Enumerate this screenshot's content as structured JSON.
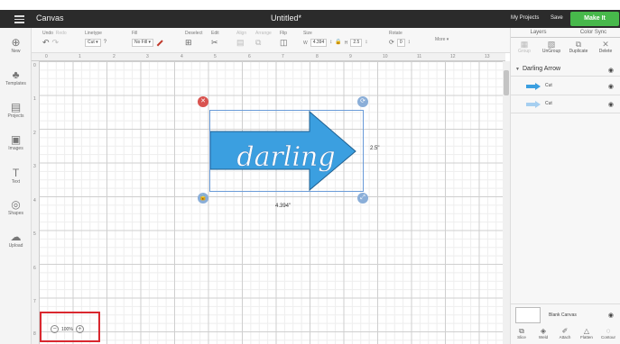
{
  "header": {
    "app_title": "Canvas",
    "doc_title": "Untitled*",
    "my_projects": "My Projects",
    "save": "Save",
    "make_it": "Make It"
  },
  "toolbar": {
    "undo": "Undo",
    "redo": "Redo",
    "linetype_label": "Linetype",
    "linetype_value": "Cut",
    "fill_label": "Fill",
    "fill_value": "No Fill",
    "deselect": "Deselect",
    "edit": "Edit",
    "align": "Align",
    "arrange": "Arrange",
    "flip": "Flip",
    "size_label": "Size",
    "w_label": "W",
    "w_value": "4.394",
    "h_label": "H",
    "h_value": "2.5",
    "rotate_label": "Rotate",
    "rotate_value": "0",
    "more": "More ▾",
    "question": "?"
  },
  "sidebar": {
    "items": [
      {
        "label": "New",
        "icon": "⊕"
      },
      {
        "label": "Templates",
        "icon": "♣"
      },
      {
        "label": "Projects",
        "icon": "▤"
      },
      {
        "label": "Images",
        "icon": "▣"
      },
      {
        "label": "Text",
        "icon": "T"
      },
      {
        "label": "Shapes",
        "icon": "◎"
      },
      {
        "label": "Upload",
        "icon": "☁"
      }
    ]
  },
  "rulers": {
    "top": [
      "0",
      "1",
      "2",
      "3",
      "4",
      "5",
      "6",
      "7",
      "8",
      "9",
      "10",
      "11",
      "12",
      "13"
    ],
    "left": [
      "0",
      "1",
      "2",
      "3",
      "4",
      "5",
      "6",
      "7",
      "8"
    ]
  },
  "canvas": {
    "object_text": "darling",
    "width_label": "4.394\"",
    "height_label": "2.5\"",
    "arrow_color": "#3b9fe0",
    "selection_color": "#6a9bd8"
  },
  "zoom": {
    "value": "100%",
    "minus": "−",
    "plus": "+"
  },
  "layers_panel": {
    "tab_layers": "Layers",
    "tab_color_sync": "Color Sync",
    "tools": [
      {
        "label": "Group",
        "icon": "▦",
        "enabled": false
      },
      {
        "label": "UnGroup",
        "icon": "▧",
        "enabled": true
      },
      {
        "label": "Duplicate",
        "icon": "⧉",
        "enabled": true
      },
      {
        "label": "Delete",
        "icon": "✕",
        "enabled": true
      }
    ],
    "group_name": "Darling Arrow",
    "layers": [
      {
        "name": "Cut",
        "color": "#3b9fe0"
      },
      {
        "name": "Cut",
        "color": "#a6cff0"
      }
    ],
    "blank_canvas": "Blank Canvas",
    "bottom_tools": [
      {
        "label": "Slice",
        "icon": "⧉"
      },
      {
        "label": "Weld",
        "icon": "◈"
      },
      {
        "label": "Attach",
        "icon": "✐"
      },
      {
        "label": "Flatten",
        "icon": "△"
      },
      {
        "label": "Contour",
        "icon": "◌"
      }
    ]
  }
}
